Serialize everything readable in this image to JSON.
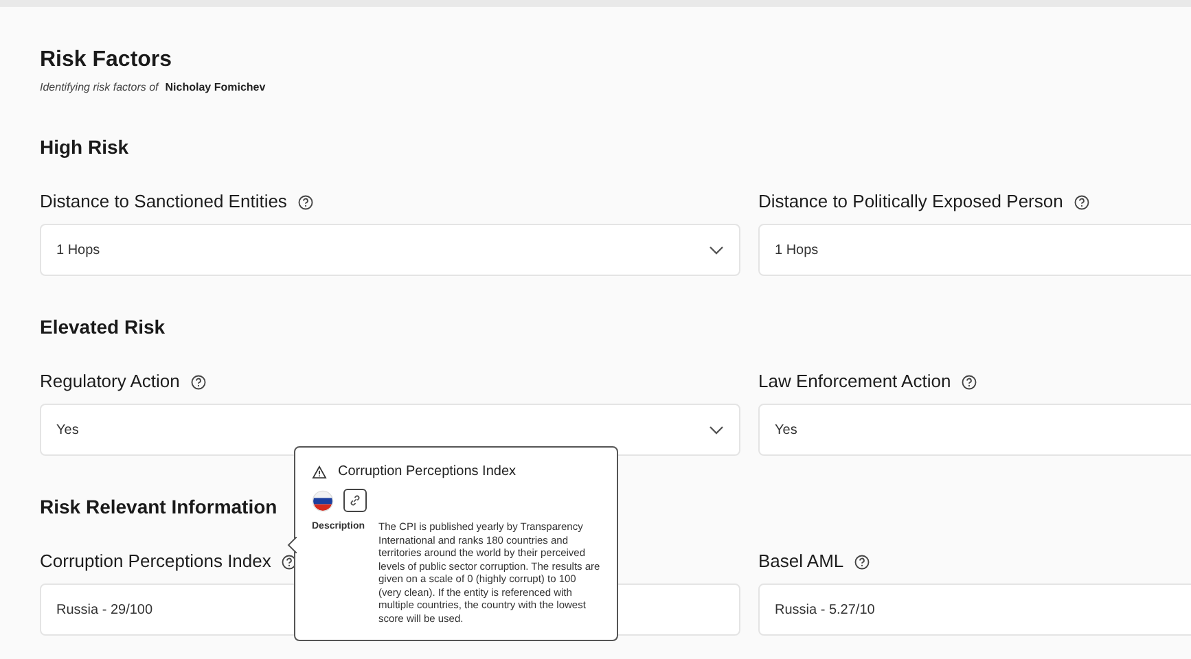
{
  "title": "Risk Factors",
  "subtitle": {
    "prefix": "Identifying risk factors of",
    "name": "Nicholay Fomichev"
  },
  "sections": [
    {
      "heading": "High Risk",
      "fields": [
        {
          "label": "Distance to Sanctioned Entities",
          "value": "1 Hops",
          "dropdown": true
        },
        {
          "label": "Distance to Politically Exposed Person",
          "value": "1 Hops"
        }
      ]
    },
    {
      "heading": "Elevated Risk",
      "fields": [
        {
          "label": "Regulatory Action",
          "value": "Yes",
          "dropdown": true
        },
        {
          "label": "Law Enforcement Action",
          "value": "Yes"
        }
      ]
    },
    {
      "heading": "Risk Relevant Information",
      "fields": [
        {
          "label": "Corruption Perceptions Index",
          "value": "Russia - 29/100",
          "dropdown": false
        },
        {
          "label": "Basel AML",
          "value": "Russia - 5.27/10"
        }
      ]
    }
  ],
  "tooltip": {
    "title": "Corruption Perceptions Index",
    "description_label": "Description",
    "description": "The CPI is published yearly by Transparency International and ranks 180 countries and territories around the world by their perceived levels of public sector corruption. The results are given on a scale of 0 (highly corrupt) to 100 (very clean). If the entity is referenced with multiple countries, the country with the lowest score will be used."
  }
}
